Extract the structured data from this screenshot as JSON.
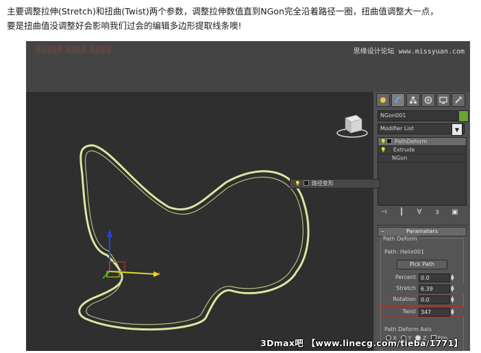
{
  "caption": {
    "line1": "主要调整拉伸(Stretch)和扭曲(Twist)两个参数，调整拉伸数值直到NGon完全沿着路径一圈，扭曲值调整大一点，",
    "line2": "要是扭曲值没调整好会影响我们过会的编辑多边形提取线条噢!"
  },
  "watermark": {
    "top_right": "思缘设计论坛 www.missyuan.com"
  },
  "viewport": {
    "axis_x_label": "x",
    "floating_label": "路径变形",
    "gizmo_colors": {
      "x": "#cc2222",
      "y": "#22bb22",
      "z": "#2244dd",
      "curve": "#e8f0a8"
    }
  },
  "command_panel": {
    "tabs": [
      "create-icon",
      "modify-icon",
      "hierarchy-icon",
      "motion-icon",
      "display-icon",
      "utilities-icon"
    ],
    "object_name": "NGon001",
    "object_color": "#6aa42f",
    "modifier_list_label": "Modifier List",
    "stack": [
      {
        "name": "PathDeform",
        "selected": true
      },
      {
        "name": "Extrude",
        "selected": false
      },
      {
        "name": "NGon",
        "selected": false
      }
    ],
    "parameters": {
      "rollout_title": "Parameters",
      "group_title": "Path Deform",
      "path_label": "Path: Helix001",
      "pick_path_button": "Pick Path",
      "percent": {
        "label": "Percent",
        "value": "0.0"
      },
      "stretch": {
        "label": "Stretch",
        "value": "6.39"
      },
      "rotation": {
        "label": "Rotation",
        "value": "0.0"
      },
      "twist": {
        "label": "Twist",
        "value": "347"
      },
      "axis_title": "Path Deform Axis",
      "axes": {
        "x": "X",
        "y": "Y",
        "z": "Z",
        "selected": "z"
      },
      "flip_label": "Flip"
    }
  },
  "brand": "3Dmax吧 【www.linecg.com/tieba/1771】"
}
